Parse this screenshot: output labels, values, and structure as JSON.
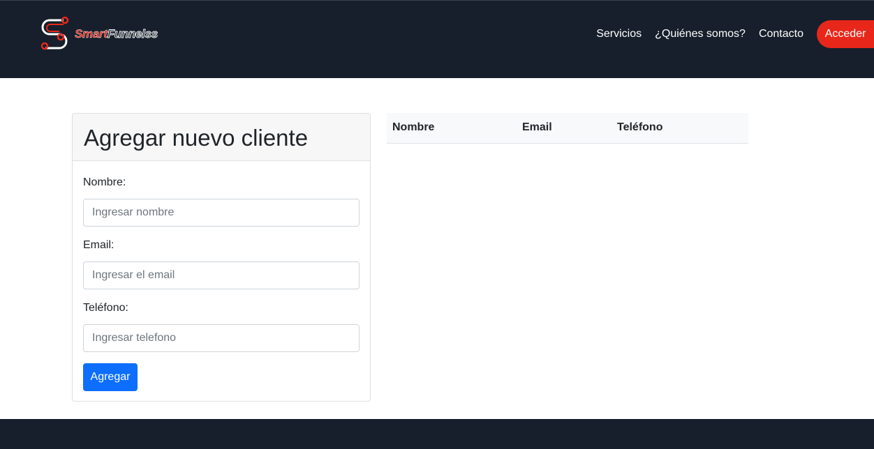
{
  "brand": {
    "logo_part1": "Smart",
    "logo_part2": "Funnelss",
    "colors": {
      "nav_bg": "#161f2b",
      "accent": "#e8271b",
      "primary": "#0d6efd"
    }
  },
  "nav": {
    "links": [
      "Servicios",
      "¿Quiénes somos?",
      "Contacto"
    ],
    "cta_label": "Acceder"
  },
  "form": {
    "title": "Agregar nuevo cliente",
    "fields": [
      {
        "label": "Nombre:",
        "placeholder": "Ingresar nombre"
      },
      {
        "label": "Email:",
        "placeholder": "Ingresar el email"
      },
      {
        "label": "Teléfono:",
        "placeholder": "Ingresar telefono"
      }
    ],
    "submit_label": "Agregar"
  },
  "table": {
    "headers": [
      "Nombre",
      "Email",
      "Teléfono"
    ],
    "rows": []
  }
}
